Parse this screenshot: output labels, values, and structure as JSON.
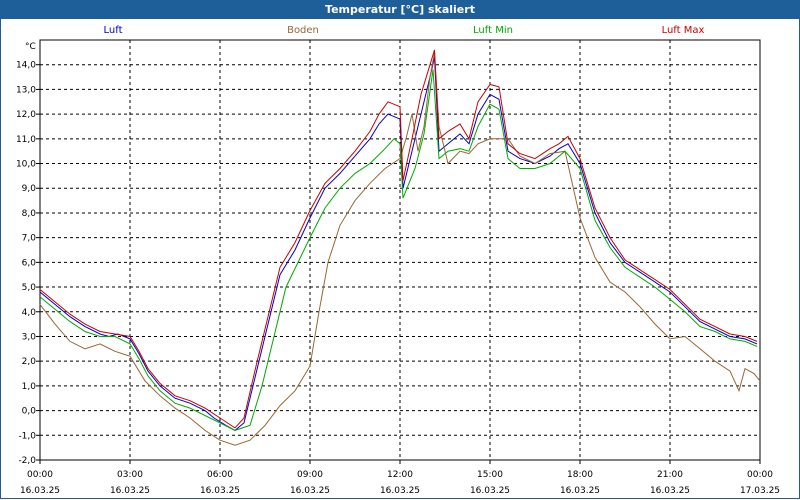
{
  "window": {
    "title": "Temperatur [°C] skaliert"
  },
  "chart_data": {
    "type": "line",
    "title": "Temperatur [°C] skaliert",
    "ylabel": "°C",
    "ylim": [
      -2.0,
      15.0
    ],
    "y_ticks": [
      -2.0,
      -1.0,
      0.0,
      1.0,
      2.0,
      3.0,
      4.0,
      5.0,
      6.0,
      7.0,
      8.0,
      9.0,
      10.0,
      11.0,
      12.0,
      13.0,
      14.0
    ],
    "y_tick_labels": [
      "-2,0",
      "-1,0",
      "0,0",
      "1,0",
      "2,0",
      "3,0",
      "4,0",
      "5,0",
      "6,0",
      "7,0",
      "8,0",
      "9,0",
      "10,0",
      "11,0",
      "12,0",
      "13,0",
      "14,0"
    ],
    "xlim": [
      0,
      24
    ],
    "x_ticks": [
      0,
      3,
      6,
      9,
      12,
      15,
      18,
      21,
      24
    ],
    "x_tick_labels": [
      [
        "00:00",
        "16.03.25"
      ],
      [
        "03:00",
        "16.03.25"
      ],
      [
        "06:00",
        "16.03.25"
      ],
      [
        "09:00",
        "16.03.25"
      ],
      [
        "12:00",
        "16.03.25"
      ],
      [
        "15:00",
        "16.03.25"
      ],
      [
        "18:00",
        "16.03.25"
      ],
      [
        "21:00",
        "16.03.25"
      ],
      [
        "00:00",
        "17.03.25"
      ]
    ],
    "grid": true,
    "legend_position": "top",
    "series": [
      {
        "name": "Luft",
        "color": "#0000cc",
        "points": [
          [
            0,
            4.8
          ],
          [
            0.5,
            4.3
          ],
          [
            1,
            3.8
          ],
          [
            1.5,
            3.4
          ],
          [
            2,
            3.1
          ],
          [
            2.3,
            3.0
          ],
          [
            2.6,
            3.1
          ],
          [
            3,
            2.9
          ],
          [
            3.3,
            2.3
          ],
          [
            3.6,
            1.6
          ],
          [
            4,
            1.0
          ],
          [
            4.5,
            0.5
          ],
          [
            5,
            0.3
          ],
          [
            5.5,
            0.0
          ],
          [
            5.8,
            -0.3
          ],
          [
            6.2,
            -0.6
          ],
          [
            6.5,
            -0.8
          ],
          [
            6.8,
            -0.5
          ],
          [
            7.2,
            1.5
          ],
          [
            7.6,
            3.5
          ],
          [
            8,
            5.5
          ],
          [
            8.5,
            6.5
          ],
          [
            9,
            7.8
          ],
          [
            9.5,
            9.0
          ],
          [
            10,
            9.6
          ],
          [
            10.5,
            10.3
          ],
          [
            11,
            11.0
          ],
          [
            11.3,
            11.6
          ],
          [
            11.6,
            12.0
          ],
          [
            12,
            11.8
          ],
          [
            12.1,
            9.0
          ],
          [
            12.4,
            10.5
          ],
          [
            12.7,
            12.0
          ],
          [
            13,
            13.5
          ],
          [
            13.15,
            14.3
          ],
          [
            13.3,
            10.5
          ],
          [
            13.6,
            10.8
          ],
          [
            14,
            11.2
          ],
          [
            14.3,
            10.8
          ],
          [
            14.6,
            12.0
          ],
          [
            15,
            12.8
          ],
          [
            15.3,
            12.6
          ],
          [
            15.6,
            10.5
          ],
          [
            16,
            10.2
          ],
          [
            16.5,
            10.0
          ],
          [
            17,
            10.3
          ],
          [
            17.3,
            10.6
          ],
          [
            17.6,
            10.8
          ],
          [
            18,
            10.0
          ],
          [
            18.5,
            8.0
          ],
          [
            19,
            6.8
          ],
          [
            19.5,
            6.0
          ],
          [
            20,
            5.6
          ],
          [
            20.5,
            5.2
          ],
          [
            21,
            4.8
          ],
          [
            21.5,
            4.2
          ],
          [
            22,
            3.6
          ],
          [
            22.5,
            3.3
          ],
          [
            23,
            3.0
          ],
          [
            23.5,
            2.9
          ],
          [
            23.9,
            2.7
          ]
        ]
      },
      {
        "name": "Boden",
        "color": "#996633",
        "points": [
          [
            0,
            4.3
          ],
          [
            0.5,
            3.5
          ],
          [
            1,
            2.8
          ],
          [
            1.5,
            2.5
          ],
          [
            2,
            2.7
          ],
          [
            2.5,
            2.4
          ],
          [
            3,
            2.2
          ],
          [
            3.5,
            1.2
          ],
          [
            4,
            0.6
          ],
          [
            4.5,
            0.1
          ],
          [
            5,
            -0.3
          ],
          [
            5.5,
            -0.8
          ],
          [
            6,
            -1.2
          ],
          [
            6.5,
            -1.4
          ],
          [
            7,
            -1.2
          ],
          [
            7.5,
            -0.6
          ],
          [
            8,
            0.2
          ],
          [
            8.5,
            0.8
          ],
          [
            9,
            1.8
          ],
          [
            9.3,
            4.0
          ],
          [
            9.6,
            6.0
          ],
          [
            10,
            7.5
          ],
          [
            10.5,
            8.5
          ],
          [
            11,
            9.2
          ],
          [
            11.5,
            9.8
          ],
          [
            12,
            10.2
          ],
          [
            12.2,
            11.0
          ],
          [
            12.4,
            12.0
          ],
          [
            12.6,
            10.5
          ],
          [
            12.8,
            11.5
          ],
          [
            13,
            13.5
          ],
          [
            13.15,
            14.5
          ],
          [
            13.3,
            11.5
          ],
          [
            13.6,
            10.0
          ],
          [
            14,
            10.5
          ],
          [
            14.3,
            10.4
          ],
          [
            14.6,
            10.8
          ],
          [
            15,
            11.0
          ],
          [
            15.3,
            11.0
          ],
          [
            15.6,
            11.0
          ],
          [
            16,
            10.3
          ],
          [
            16.5,
            10.0
          ],
          [
            17,
            10.4
          ],
          [
            17.5,
            10.5
          ],
          [
            18,
            7.8
          ],
          [
            18.5,
            6.2
          ],
          [
            19,
            5.2
          ],
          [
            19.5,
            4.8
          ],
          [
            20,
            4.2
          ],
          [
            20.5,
            3.5
          ],
          [
            21,
            2.9
          ],
          [
            21.5,
            3.0
          ],
          [
            22,
            2.5
          ],
          [
            22.5,
            2.0
          ],
          [
            23,
            1.6
          ],
          [
            23.3,
            0.8
          ],
          [
            23.5,
            1.7
          ],
          [
            23.8,
            1.5
          ],
          [
            24,
            1.2
          ]
        ]
      },
      {
        "name": "Luft Min",
        "color": "#00aa00",
        "points": [
          [
            0,
            4.6
          ],
          [
            0.5,
            4.1
          ],
          [
            1,
            3.6
          ],
          [
            1.5,
            3.2
          ],
          [
            2,
            3.0
          ],
          [
            2.5,
            3.0
          ],
          [
            3,
            2.7
          ],
          [
            3.3,
            2.1
          ],
          [
            3.6,
            1.4
          ],
          [
            4,
            0.8
          ],
          [
            4.5,
            0.3
          ],
          [
            5,
            0.1
          ],
          [
            5.5,
            -0.2
          ],
          [
            6,
            -0.5
          ],
          [
            6.5,
            -0.8
          ],
          [
            7,
            -0.6
          ],
          [
            7.4,
            1.0
          ],
          [
            7.8,
            3.0
          ],
          [
            8.2,
            5.0
          ],
          [
            8.6,
            6.0
          ],
          [
            9,
            7.0
          ],
          [
            9.5,
            8.2
          ],
          [
            10,
            9.0
          ],
          [
            10.5,
            9.6
          ],
          [
            11,
            10.0
          ],
          [
            11.5,
            10.6
          ],
          [
            11.8,
            11.0
          ],
          [
            12,
            10.8
          ],
          [
            12.1,
            8.6
          ],
          [
            12.5,
            9.8
          ],
          [
            12.8,
            11.2
          ],
          [
            13.1,
            13.8
          ],
          [
            13.3,
            10.2
          ],
          [
            13.6,
            10.5
          ],
          [
            14,
            10.6
          ],
          [
            14.3,
            10.5
          ],
          [
            14.6,
            11.5
          ],
          [
            15,
            12.4
          ],
          [
            15.3,
            12.2
          ],
          [
            15.6,
            10.2
          ],
          [
            16,
            9.8
          ],
          [
            16.5,
            9.8
          ],
          [
            17,
            10.0
          ],
          [
            17.5,
            10.5
          ],
          [
            18,
            9.8
          ],
          [
            18.5,
            7.7
          ],
          [
            19,
            6.6
          ],
          [
            19.5,
            5.8
          ],
          [
            20,
            5.4
          ],
          [
            20.5,
            5.0
          ],
          [
            21,
            4.5
          ],
          [
            21.5,
            4.0
          ],
          [
            22,
            3.4
          ],
          [
            22.5,
            3.2
          ],
          [
            23,
            2.9
          ],
          [
            23.5,
            2.8
          ],
          [
            23.9,
            2.6
          ]
        ]
      },
      {
        "name": "Luft Max",
        "color": "#cc0000",
        "points": [
          [
            0,
            4.9
          ],
          [
            0.5,
            4.4
          ],
          [
            1,
            3.9
          ],
          [
            1.5,
            3.5
          ],
          [
            2,
            3.2
          ],
          [
            2.5,
            3.1
          ],
          [
            3,
            3.0
          ],
          [
            3.3,
            2.4
          ],
          [
            3.6,
            1.7
          ],
          [
            4,
            1.1
          ],
          [
            4.5,
            0.6
          ],
          [
            5,
            0.4
          ],
          [
            5.5,
            0.1
          ],
          [
            6,
            -0.3
          ],
          [
            6.5,
            -0.7
          ],
          [
            6.8,
            -0.3
          ],
          [
            7.2,
            1.8
          ],
          [
            7.6,
            3.8
          ],
          [
            8,
            5.8
          ],
          [
            8.5,
            6.8
          ],
          [
            9,
            8.1
          ],
          [
            9.5,
            9.2
          ],
          [
            10,
            9.8
          ],
          [
            10.5,
            10.5
          ],
          [
            11,
            11.3
          ],
          [
            11.3,
            12.0
          ],
          [
            11.6,
            12.5
          ],
          [
            12,
            12.3
          ],
          [
            12.1,
            9.3
          ],
          [
            12.4,
            11.0
          ],
          [
            12.7,
            12.8
          ],
          [
            13,
            14.0
          ],
          [
            13.15,
            14.6
          ],
          [
            13.3,
            11.0
          ],
          [
            13.6,
            11.3
          ],
          [
            14,
            11.6
          ],
          [
            14.3,
            11.0
          ],
          [
            14.6,
            12.5
          ],
          [
            15,
            13.2
          ],
          [
            15.3,
            13.1
          ],
          [
            15.6,
            10.8
          ],
          [
            16,
            10.4
          ],
          [
            16.5,
            10.2
          ],
          [
            17,
            10.6
          ],
          [
            17.3,
            10.8
          ],
          [
            17.6,
            11.1
          ],
          [
            18,
            10.2
          ],
          [
            18.5,
            8.2
          ],
          [
            19,
            7.0
          ],
          [
            19.5,
            6.1
          ],
          [
            20,
            5.7
          ],
          [
            20.5,
            5.3
          ],
          [
            21,
            4.9
          ],
          [
            21.5,
            4.3
          ],
          [
            22,
            3.7
          ],
          [
            22.5,
            3.4
          ],
          [
            23,
            3.1
          ],
          [
            23.5,
            3.0
          ],
          [
            23.9,
            2.8
          ]
        ]
      }
    ]
  }
}
